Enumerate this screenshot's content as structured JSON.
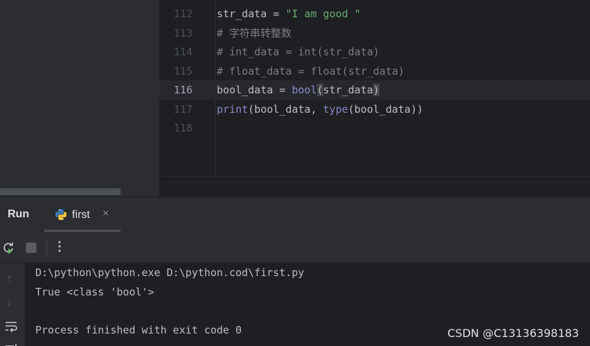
{
  "editor": {
    "lines": [
      {
        "number": "112",
        "tokens": [
          {
            "t": "plain",
            "v": "str_data = "
          },
          {
            "t": "str",
            "v": "\"I am good \""
          }
        ]
      },
      {
        "number": "113",
        "tokens": [
          {
            "t": "comment",
            "v": "# 字符串转整数"
          }
        ]
      },
      {
        "number": "114",
        "tokens": [
          {
            "t": "comment",
            "v": "# int_data = int(str_data)"
          }
        ]
      },
      {
        "number": "115",
        "tokens": [
          {
            "t": "comment",
            "v": "# float_data = float(str_data)"
          }
        ]
      },
      {
        "number": "116",
        "current": true,
        "tokens": [
          {
            "t": "plain",
            "v": "bool_data = "
          },
          {
            "t": "builtin",
            "v": "bool"
          },
          {
            "t": "paren-hl",
            "v": "("
          },
          {
            "t": "plain",
            "v": "str_data"
          },
          {
            "t": "paren-hl",
            "v": ")"
          }
        ]
      },
      {
        "number": "117",
        "tokens": [
          {
            "t": "builtin",
            "v": "print"
          },
          {
            "t": "plain",
            "v": "(bool_data, "
          },
          {
            "t": "builtin",
            "v": "type"
          },
          {
            "t": "plain",
            "v": "(bool_data))"
          }
        ]
      },
      {
        "number": "118",
        "tokens": []
      }
    ]
  },
  "run": {
    "title": "Run",
    "tab_label": "first",
    "tab_close": "×",
    "tab_icon": "python-icon",
    "toolbar": {
      "rerun_icon": "rerun-icon",
      "stop_icon": "stop-icon",
      "more": "⋮"
    },
    "side": {
      "up": "↑",
      "down": "↓",
      "wrap_icon": "soft-wrap-icon"
    },
    "console": [
      "D:\\python\\python.exe D:\\python.cod\\first.py",
      "True <class 'bool'>",
      "",
      "Process finished with exit code 0"
    ]
  },
  "watermark": "CSDN @C13136398183"
}
